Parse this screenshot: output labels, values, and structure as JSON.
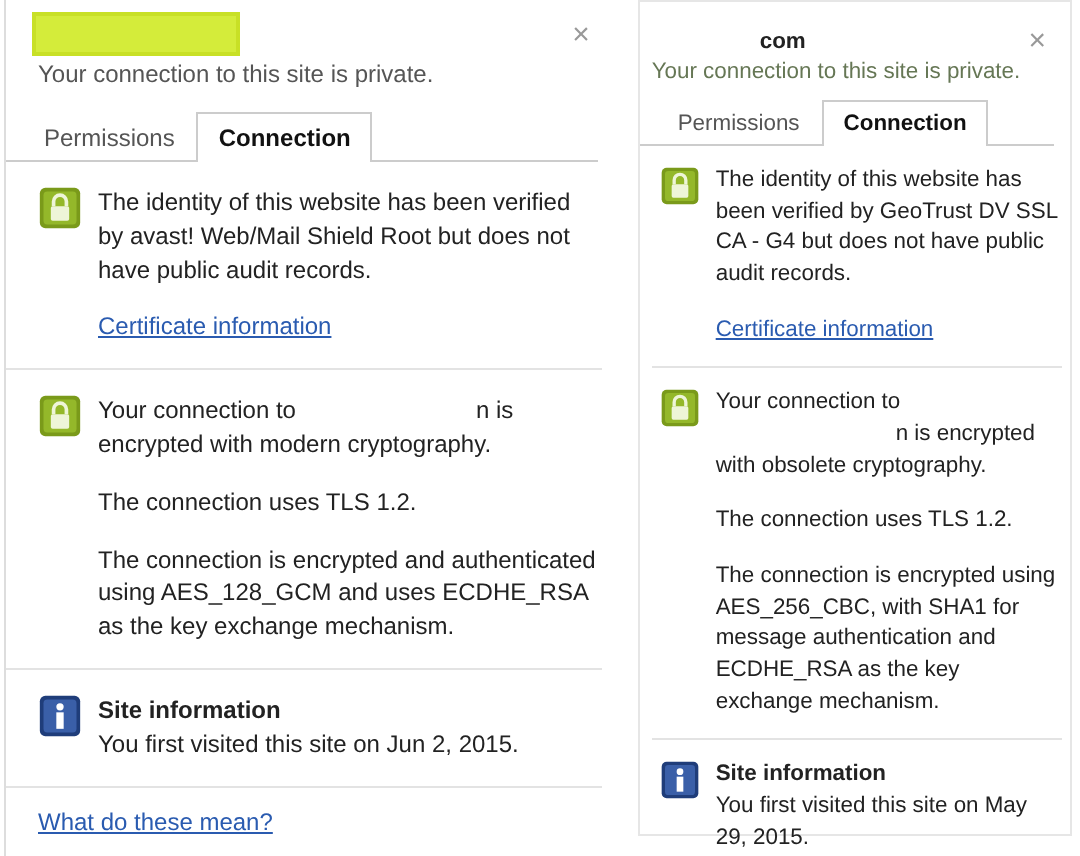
{
  "panels": [
    {
      "title": {
        "kind": "highlight"
      },
      "subtitle": "Your connection to this site is private.",
      "close": "×",
      "tabs": [
        {
          "label": "Permissions",
          "selected": false
        },
        {
          "label": "Connection",
          "selected": true
        }
      ],
      "identity": {
        "text": "The identity of this website has been verified by avast! Web/Mail Shield Root but does not have public audit records.",
        "link": "Certificate information"
      },
      "encryption": {
        "before": "Your connection to",
        "after": "n is encrypted with modern cryptography.",
        "paragraphs": [
          "The connection uses TLS 1.2.",
          "The connection is encrypted and authenticated using AES_128_GCM and uses ECDHE_RSA as the key exchange mechanism."
        ]
      },
      "site_info": {
        "heading": "Site information",
        "text": "You first visited this site on Jun 2, 2015."
      },
      "help_link": "What do these mean?"
    },
    {
      "title": {
        "kind": "redacted",
        "text": "com"
      },
      "subtitle": "Your connection to this site is private.",
      "close": "×",
      "tabs": [
        {
          "label": "Permissions",
          "selected": false
        },
        {
          "label": "Connection",
          "selected": true
        }
      ],
      "identity": {
        "text": "The identity of this website has been verified by GeoTrust DV SSL CA - G4 but does not have public audit records.",
        "link": "Certificate information"
      },
      "encryption": {
        "before": "Your connection to",
        "after": "n is encrypted with obsolete cryptography.",
        "paragraphs": [
          "The connection uses TLS 1.2.",
          "The connection is encrypted using AES_256_CBC, with SHA1 for message authentication and ECDHE_RSA as the key exchange mechanism."
        ]
      },
      "site_info": {
        "heading": "Site information",
        "text": "You first visited this site on May 29, 2015."
      }
    }
  ]
}
